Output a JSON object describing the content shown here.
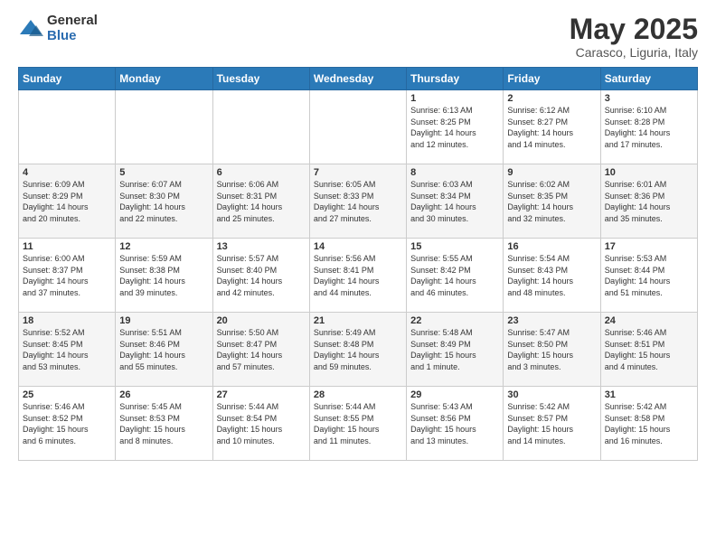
{
  "header": {
    "logo_general": "General",
    "logo_blue": "Blue",
    "title": "May 2025",
    "subtitle": "Carasco, Liguria, Italy"
  },
  "weekdays": [
    "Sunday",
    "Monday",
    "Tuesday",
    "Wednesday",
    "Thursday",
    "Friday",
    "Saturday"
  ],
  "weeks": [
    [
      {
        "day": "",
        "info": ""
      },
      {
        "day": "",
        "info": ""
      },
      {
        "day": "",
        "info": ""
      },
      {
        "day": "",
        "info": ""
      },
      {
        "day": "1",
        "info": "Sunrise: 6:13 AM\nSunset: 8:25 PM\nDaylight: 14 hours\nand 12 minutes."
      },
      {
        "day": "2",
        "info": "Sunrise: 6:12 AM\nSunset: 8:27 PM\nDaylight: 14 hours\nand 14 minutes."
      },
      {
        "day": "3",
        "info": "Sunrise: 6:10 AM\nSunset: 8:28 PM\nDaylight: 14 hours\nand 17 minutes."
      }
    ],
    [
      {
        "day": "4",
        "info": "Sunrise: 6:09 AM\nSunset: 8:29 PM\nDaylight: 14 hours\nand 20 minutes."
      },
      {
        "day": "5",
        "info": "Sunrise: 6:07 AM\nSunset: 8:30 PM\nDaylight: 14 hours\nand 22 minutes."
      },
      {
        "day": "6",
        "info": "Sunrise: 6:06 AM\nSunset: 8:31 PM\nDaylight: 14 hours\nand 25 minutes."
      },
      {
        "day": "7",
        "info": "Sunrise: 6:05 AM\nSunset: 8:33 PM\nDaylight: 14 hours\nand 27 minutes."
      },
      {
        "day": "8",
        "info": "Sunrise: 6:03 AM\nSunset: 8:34 PM\nDaylight: 14 hours\nand 30 minutes."
      },
      {
        "day": "9",
        "info": "Sunrise: 6:02 AM\nSunset: 8:35 PM\nDaylight: 14 hours\nand 32 minutes."
      },
      {
        "day": "10",
        "info": "Sunrise: 6:01 AM\nSunset: 8:36 PM\nDaylight: 14 hours\nand 35 minutes."
      }
    ],
    [
      {
        "day": "11",
        "info": "Sunrise: 6:00 AM\nSunset: 8:37 PM\nDaylight: 14 hours\nand 37 minutes."
      },
      {
        "day": "12",
        "info": "Sunrise: 5:59 AM\nSunset: 8:38 PM\nDaylight: 14 hours\nand 39 minutes."
      },
      {
        "day": "13",
        "info": "Sunrise: 5:57 AM\nSunset: 8:40 PM\nDaylight: 14 hours\nand 42 minutes."
      },
      {
        "day": "14",
        "info": "Sunrise: 5:56 AM\nSunset: 8:41 PM\nDaylight: 14 hours\nand 44 minutes."
      },
      {
        "day": "15",
        "info": "Sunrise: 5:55 AM\nSunset: 8:42 PM\nDaylight: 14 hours\nand 46 minutes."
      },
      {
        "day": "16",
        "info": "Sunrise: 5:54 AM\nSunset: 8:43 PM\nDaylight: 14 hours\nand 48 minutes."
      },
      {
        "day": "17",
        "info": "Sunrise: 5:53 AM\nSunset: 8:44 PM\nDaylight: 14 hours\nand 51 minutes."
      }
    ],
    [
      {
        "day": "18",
        "info": "Sunrise: 5:52 AM\nSunset: 8:45 PM\nDaylight: 14 hours\nand 53 minutes."
      },
      {
        "day": "19",
        "info": "Sunrise: 5:51 AM\nSunset: 8:46 PM\nDaylight: 14 hours\nand 55 minutes."
      },
      {
        "day": "20",
        "info": "Sunrise: 5:50 AM\nSunset: 8:47 PM\nDaylight: 14 hours\nand 57 minutes."
      },
      {
        "day": "21",
        "info": "Sunrise: 5:49 AM\nSunset: 8:48 PM\nDaylight: 14 hours\nand 59 minutes."
      },
      {
        "day": "22",
        "info": "Sunrise: 5:48 AM\nSunset: 8:49 PM\nDaylight: 15 hours\nand 1 minute."
      },
      {
        "day": "23",
        "info": "Sunrise: 5:47 AM\nSunset: 8:50 PM\nDaylight: 15 hours\nand 3 minutes."
      },
      {
        "day": "24",
        "info": "Sunrise: 5:46 AM\nSunset: 8:51 PM\nDaylight: 15 hours\nand 4 minutes."
      }
    ],
    [
      {
        "day": "25",
        "info": "Sunrise: 5:46 AM\nSunset: 8:52 PM\nDaylight: 15 hours\nand 6 minutes."
      },
      {
        "day": "26",
        "info": "Sunrise: 5:45 AM\nSunset: 8:53 PM\nDaylight: 15 hours\nand 8 minutes."
      },
      {
        "day": "27",
        "info": "Sunrise: 5:44 AM\nSunset: 8:54 PM\nDaylight: 15 hours\nand 10 minutes."
      },
      {
        "day": "28",
        "info": "Sunrise: 5:44 AM\nSunset: 8:55 PM\nDaylight: 15 hours\nand 11 minutes."
      },
      {
        "day": "29",
        "info": "Sunrise: 5:43 AM\nSunset: 8:56 PM\nDaylight: 15 hours\nand 13 minutes."
      },
      {
        "day": "30",
        "info": "Sunrise: 5:42 AM\nSunset: 8:57 PM\nDaylight: 15 hours\nand 14 minutes."
      },
      {
        "day": "31",
        "info": "Sunrise: 5:42 AM\nSunset: 8:58 PM\nDaylight: 15 hours\nand 16 minutes."
      }
    ]
  ]
}
